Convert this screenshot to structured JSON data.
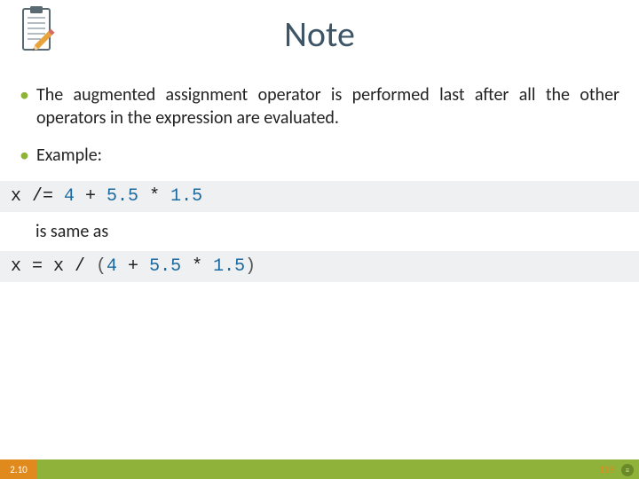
{
  "title": "Note",
  "bullets": [
    "The augmented assignment operator is performed last after all the other operators in the expression are evaluated.",
    "Example:"
  ],
  "code1": {
    "pre": "x /= ",
    "n1": "4",
    "mid1": " + ",
    "n2": "5.5",
    "mid2": " * ",
    "n3": "1.5"
  },
  "sameas": "is same as",
  "code2": {
    "pre": "x = x / ",
    "lp": "(",
    "n1": "4",
    "mid1": " + ",
    "n2": "5.5",
    "mid2": " * ",
    "n3": "1.5",
    "rp": ")"
  },
  "footer": {
    "section": "2.10",
    "page": "119"
  },
  "icon": {
    "name": "clipboard-pencil"
  }
}
